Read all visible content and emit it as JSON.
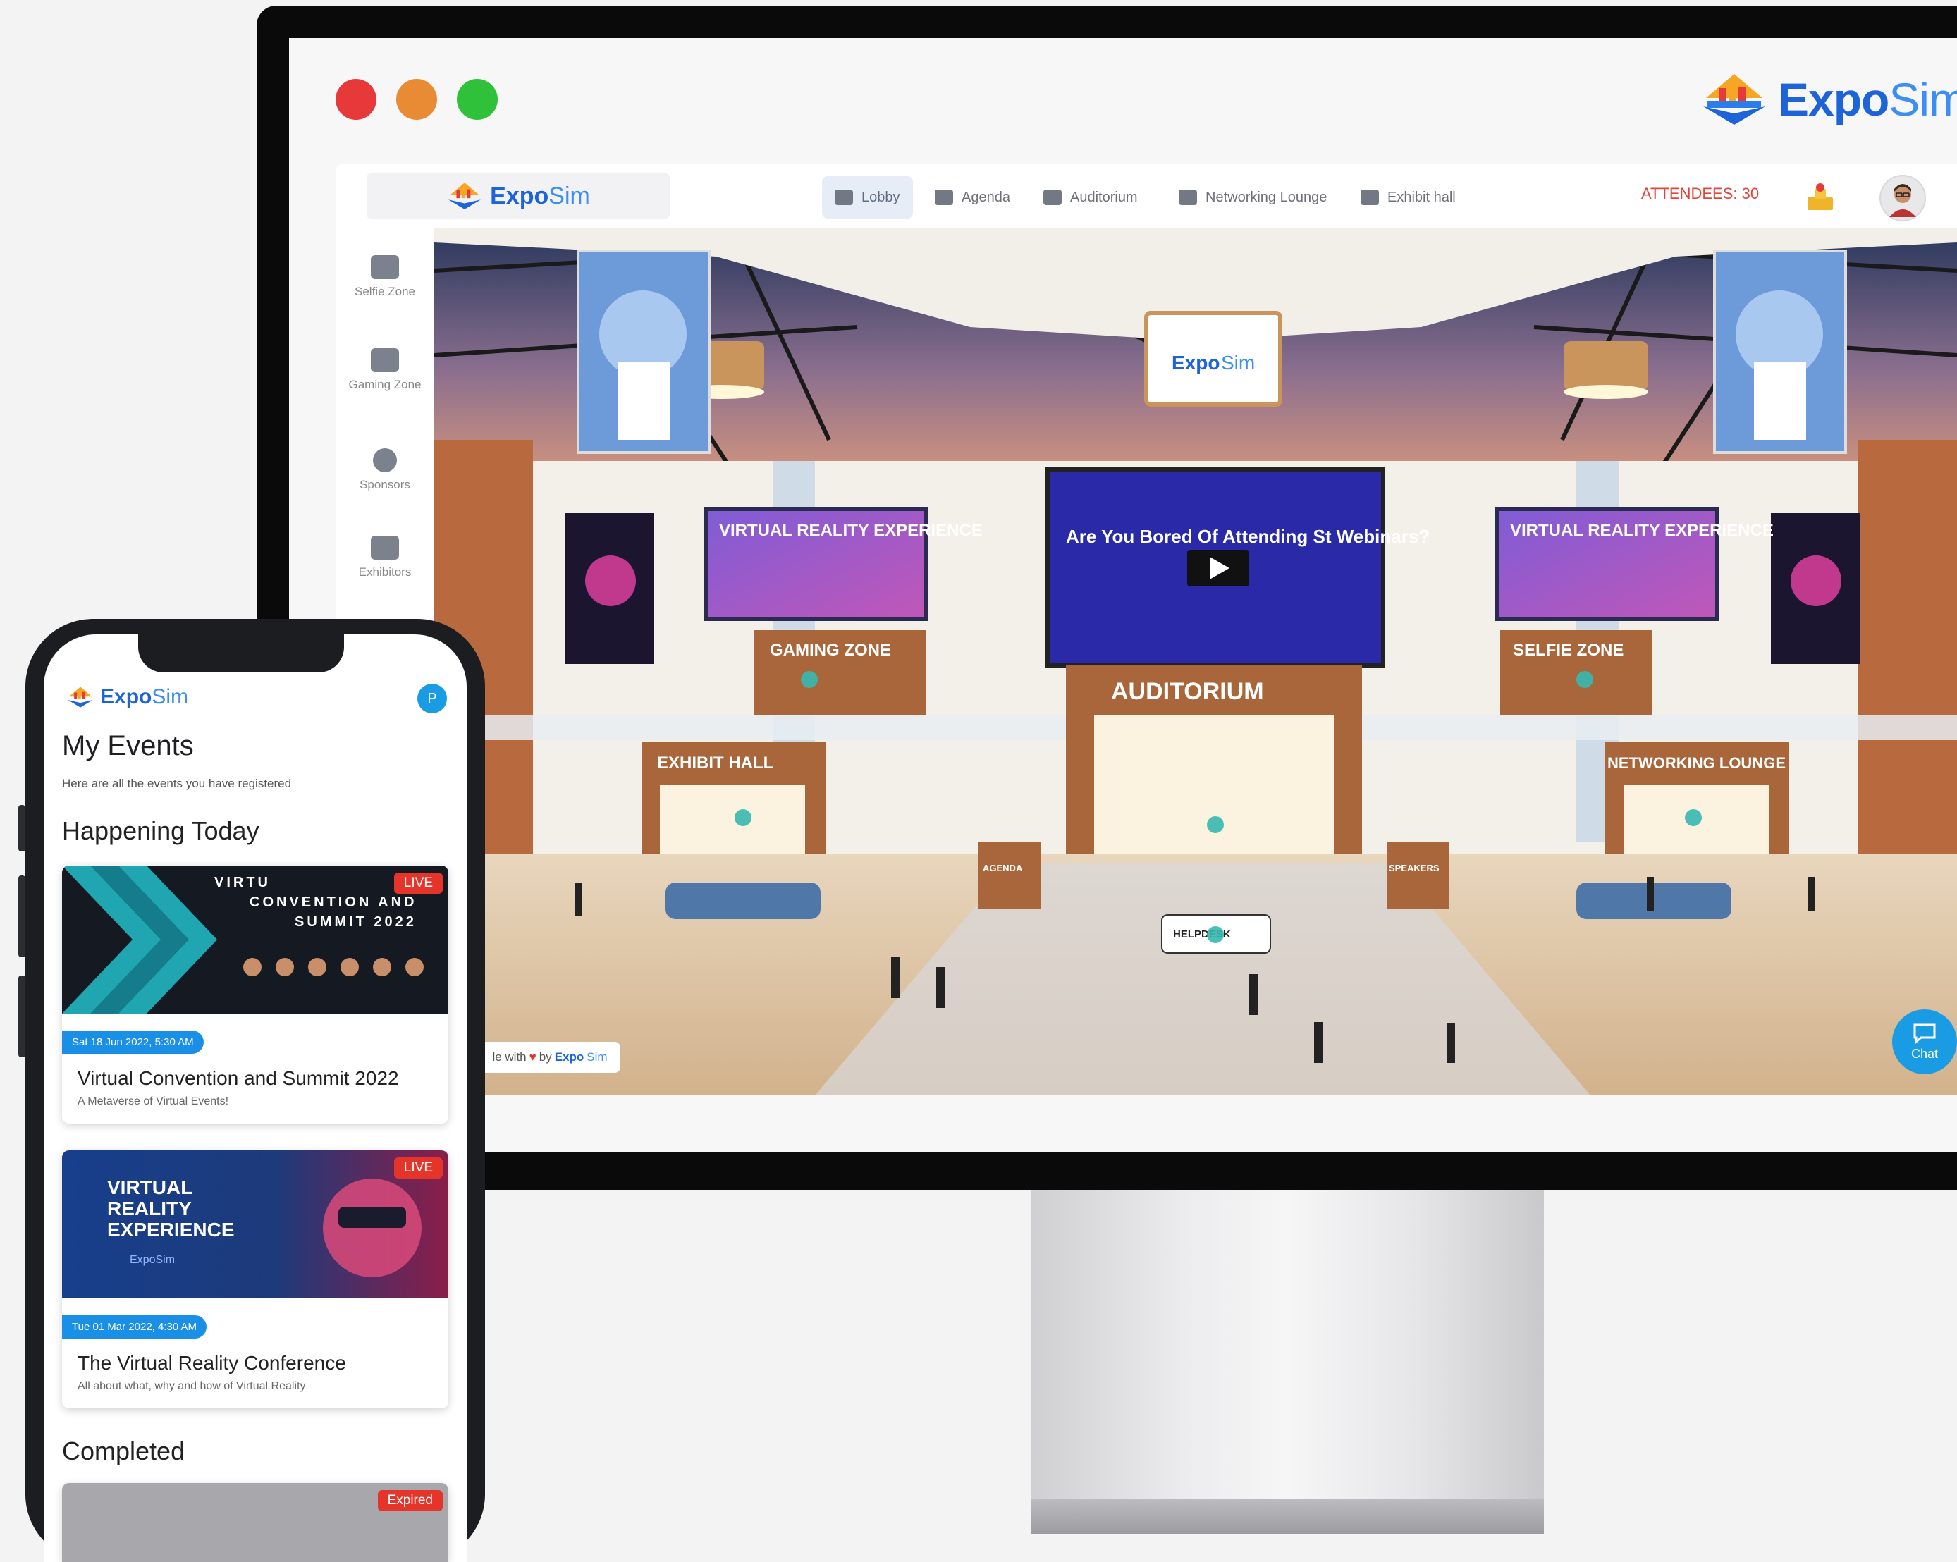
{
  "colors": {
    "red_dot": "#e8393a",
    "orange_dot": "#e98a35",
    "green_dot": "#2fc13a",
    "accent": "#1a9ce4",
    "live": "#e5352b"
  },
  "desktop": {
    "brand": {
      "part1": "Expo",
      "part2": "Sim"
    },
    "app": {
      "logo": {
        "part1": "Expo",
        "part2": "Sim"
      },
      "nav": [
        {
          "label": "Lobby",
          "icon": "lobby-icon"
        },
        {
          "label": "Agenda",
          "icon": "calendar-icon"
        },
        {
          "label": "Auditorium",
          "icon": "auditorium-icon"
        },
        {
          "label": "Networking Lounge",
          "icon": "networking-icon"
        },
        {
          "label": "Exhibit hall",
          "icon": "exhibit-icon"
        }
      ],
      "attendees": "ATTENDEES: 30",
      "sidebar": [
        {
          "label": "Selfie Zone",
          "icon": "selfie-icon"
        },
        {
          "label": "Gaming Zone",
          "icon": "gamepad-icon"
        },
        {
          "label": "Sponsors",
          "icon": "sponsors-icon"
        },
        {
          "label": "Exhibitors",
          "icon": "exhibitors-icon"
        }
      ],
      "scene": {
        "ceiling_logo": {
          "part1": "Expo",
          "part2": "Sim"
        },
        "banner_logo": "ExpoSim",
        "vr_sign": "VIRTUAL REALITY EXPERIENCE",
        "video_text": "Are You Bored Of Attending St Webinars?",
        "gaming_zone": "GAMING ZONE",
        "selfie_zone": "SELFIE ZONE",
        "auditorium": "AUDITORIUM",
        "exhibit_hall": "EXHIBIT HALL",
        "networking_lounge": "NETWORKING LOUNGE",
        "helpdesk": "HELPDESK",
        "agenda_kiosk": "AGENDA",
        "speakers_kiosk": "SPEAKERS"
      },
      "made_with": {
        "prefix": "le with",
        "by": "by",
        "brand1": "Expo",
        "brand2": "Sim"
      },
      "chat": "Chat"
    }
  },
  "mobile": {
    "logo": {
      "part1": "Expo",
      "part2": "Sim"
    },
    "avatar_initial": "P",
    "title": "My Events",
    "subtitle": "Here are all the events you have registered",
    "section_today": "Happening Today",
    "section_completed": "Completed",
    "events": [
      {
        "banner_line1": "VIRTU",
        "banner_line2": "CONVENTION AND",
        "banner_line3": "SUMMIT 2022",
        "badge": "LIVE",
        "date": "Sat 18 Jun 2022, 5:30 AM",
        "title": "Virtual Convention and Summit 2022",
        "description": "A Metaverse of Virtual Events!"
      },
      {
        "banner_line1": "VIRTUAL",
        "banner_line2": "REALITY",
        "banner_line3": "EXPERIENCE",
        "banner_logo": "ExpoSim",
        "badge": "LIVE",
        "date": "Tue 01 Mar 2022, 4:30 AM",
        "title": "The Virtual Reality Conference",
        "description": "All about what, why and how of Virtual Reality"
      }
    ],
    "completed_badge": "Expired"
  }
}
